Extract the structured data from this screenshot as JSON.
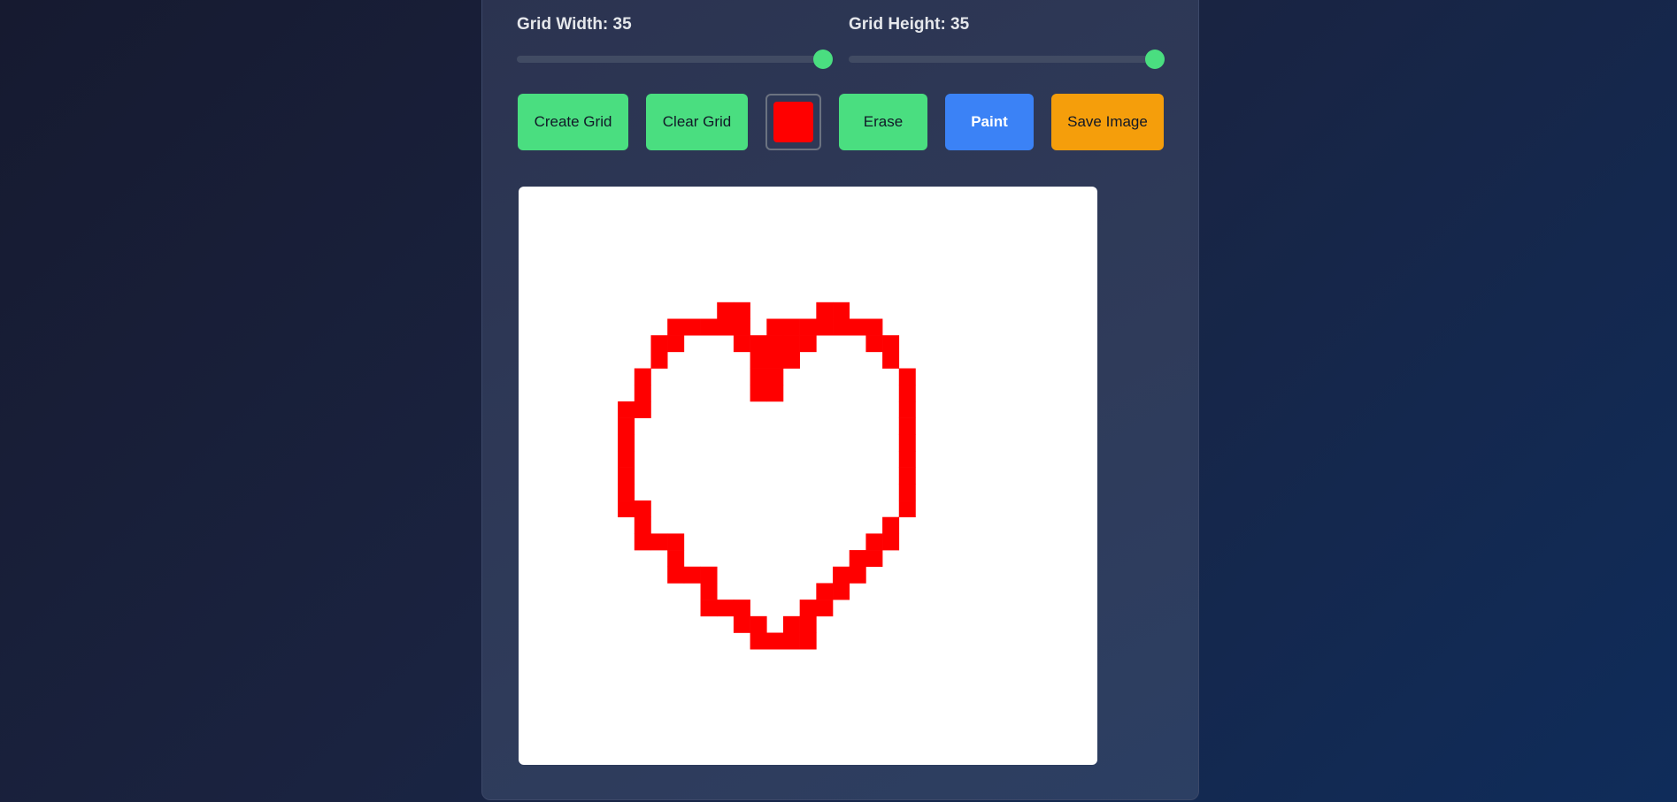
{
  "controls": {
    "grid_width_label": "Grid Width: 35",
    "grid_height_label": "Grid Height: 35",
    "grid_width_value": 35,
    "grid_height_value": 35,
    "slider_min": 1,
    "slider_max": 36
  },
  "toolbar": {
    "create_label": "Create Grid",
    "clear_label": "Clear Grid",
    "erase_label": "Erase",
    "paint_label": "Paint",
    "save_label": "Save Image",
    "selected_color": "#ff0000",
    "active_mode": "Paint"
  },
  "colors": {
    "accent_green": "#4ade80",
    "paint_blue": "#3b82f6",
    "save_orange": "#f59e0b",
    "paint_color": "#ff0000",
    "canvas_bg": "#ffffff"
  },
  "grid": {
    "columns": 35,
    "rows": 35,
    "filled_cells": [
      [
        12,
        7
      ],
      [
        13,
        7
      ],
      [
        18,
        7
      ],
      [
        19,
        7
      ],
      [
        9,
        8
      ],
      [
        10,
        8
      ],
      [
        11,
        8
      ],
      [
        12,
        8
      ],
      [
        13,
        8
      ],
      [
        15,
        8
      ],
      [
        16,
        8
      ],
      [
        17,
        8
      ],
      [
        18,
        8
      ],
      [
        19,
        8
      ],
      [
        20,
        8
      ],
      [
        21,
        8
      ],
      [
        8,
        9
      ],
      [
        9,
        9
      ],
      [
        13,
        9
      ],
      [
        14,
        9
      ],
      [
        15,
        9
      ],
      [
        16,
        9
      ],
      [
        17,
        9
      ],
      [
        21,
        9
      ],
      [
        22,
        9
      ],
      [
        8,
        10
      ],
      [
        14,
        10
      ],
      [
        15,
        10
      ],
      [
        16,
        10
      ],
      [
        22,
        10
      ],
      [
        7,
        11
      ],
      [
        14,
        11
      ],
      [
        15,
        11
      ],
      [
        23,
        11
      ],
      [
        7,
        12
      ],
      [
        14,
        12
      ],
      [
        15,
        12
      ],
      [
        23,
        12
      ],
      [
        6,
        13
      ],
      [
        7,
        13
      ],
      [
        23,
        13
      ],
      [
        6,
        14
      ],
      [
        23,
        14
      ],
      [
        6,
        15
      ],
      [
        23,
        15
      ],
      [
        6,
        16
      ],
      [
        23,
        16
      ],
      [
        6,
        17
      ],
      [
        23,
        17
      ],
      [
        6,
        18
      ],
      [
        23,
        18
      ],
      [
        6,
        19
      ],
      [
        7,
        19
      ],
      [
        23,
        19
      ],
      [
        7,
        20
      ],
      [
        22,
        20
      ],
      [
        7,
        21
      ],
      [
        8,
        21
      ],
      [
        9,
        21
      ],
      [
        21,
        21
      ],
      [
        22,
        21
      ],
      [
        9,
        22
      ],
      [
        20,
        22
      ],
      [
        21,
        22
      ],
      [
        9,
        23
      ],
      [
        10,
        23
      ],
      [
        11,
        23
      ],
      [
        19,
        23
      ],
      [
        20,
        23
      ],
      [
        11,
        24
      ],
      [
        18,
        24
      ],
      [
        19,
        24
      ],
      [
        11,
        25
      ],
      [
        12,
        25
      ],
      [
        13,
        25
      ],
      [
        17,
        25
      ],
      [
        18,
        25
      ],
      [
        13,
        26
      ],
      [
        14,
        26
      ],
      [
        16,
        26
      ],
      [
        17,
        26
      ],
      [
        14,
        27
      ],
      [
        15,
        27
      ],
      [
        16,
        27
      ],
      [
        17,
        27
      ]
    ]
  }
}
